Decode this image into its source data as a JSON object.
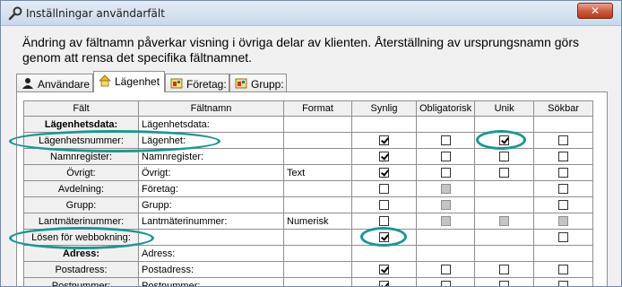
{
  "window": {
    "title": "Inställningar användarfält",
    "close_symbol": "✕",
    "title_icon": "wrench-icon"
  },
  "description": "Ändring av fältnamn påverkar visning i övriga delar av klienten. Återställning av ursprungsnamn görs genom att rensa det specifika fältnamnet.",
  "tabs": [
    {
      "label": "Användare",
      "icon": "user-icon"
    },
    {
      "label": "Lägenhet",
      "icon": "house-icon"
    },
    {
      "label": "Företag:",
      "icon": "company-icon"
    },
    {
      "label": "Grupp:",
      "icon": "group-icon"
    }
  ],
  "table": {
    "headers": [
      "Fält",
      "Fältnamn",
      "Format",
      "Synlig",
      "Obligatorisk",
      "Unik",
      "Sökbar"
    ],
    "rows": [
      {
        "falt": "Lägenhetsdata:",
        "faltnamn": "Lägenhetsdata:",
        "format": "",
        "bold": true,
        "synlig": null,
        "obligatorisk": null,
        "unik": null,
        "sokbar": null
      },
      {
        "falt": "Lägenhetsnummer:",
        "faltnamn": "Lägenhet:",
        "format": "",
        "bold": false,
        "synlig": "checked",
        "obligatorisk": "unchecked",
        "unik": "checked",
        "sokbar": "unchecked"
      },
      {
        "falt": "Namnregister:",
        "faltnamn": "Namnregister:",
        "format": "",
        "bold": false,
        "synlig": "checked",
        "obligatorisk": "unchecked",
        "unik": "unchecked",
        "sokbar": "unchecked"
      },
      {
        "falt": "Övrigt:",
        "faltnamn": "Övrigt:",
        "format": "Text",
        "bold": false,
        "synlig": "checked",
        "obligatorisk": "unchecked",
        "unik": "unchecked",
        "sokbar": "unchecked"
      },
      {
        "falt": "Avdelning:",
        "faltnamn": "Företag:",
        "format": "",
        "bold": false,
        "synlig": "unchecked",
        "obligatorisk": "disabled",
        "unik": null,
        "sokbar": "unchecked"
      },
      {
        "falt": "Grupp:",
        "faltnamn": "Grupp:",
        "format": "",
        "bold": false,
        "synlig": "unchecked",
        "obligatorisk": "disabled",
        "unik": null,
        "sokbar": "unchecked"
      },
      {
        "falt": "Lantmäterinummer:",
        "faltnamn": "Lantmäterinummer:",
        "format": "Numerisk",
        "bold": false,
        "synlig": "unchecked",
        "obligatorisk": "disabled",
        "unik": "disabled",
        "sokbar": "disabled"
      },
      {
        "falt": "Lösen för webbokning:",
        "faltnamn": "",
        "format": "",
        "bold": false,
        "synlig": "checked",
        "obligatorisk": null,
        "unik": null,
        "sokbar": "unchecked"
      },
      {
        "falt": "Adress:",
        "faltnamn": "Adress:",
        "format": "",
        "bold": true,
        "synlig": null,
        "obligatorisk": null,
        "unik": null,
        "sokbar": null
      },
      {
        "falt": "Postadress:",
        "faltnamn": "Postadress:",
        "format": "",
        "bold": false,
        "synlig": "checked",
        "obligatorisk": "unchecked",
        "unik": "unchecked",
        "sokbar": "unchecked"
      },
      {
        "falt": "Postnummer:",
        "faltnamn": "Postnummer:",
        "format": "",
        "bold": false,
        "synlig": "checked",
        "obligatorisk": "unchecked",
        "unik": "unchecked",
        "sokbar": "unchecked"
      }
    ]
  },
  "colors": {
    "highlight_ring": "#1c9690",
    "close_button": "#c75a3f",
    "title_bar": "#c9d9ea"
  }
}
